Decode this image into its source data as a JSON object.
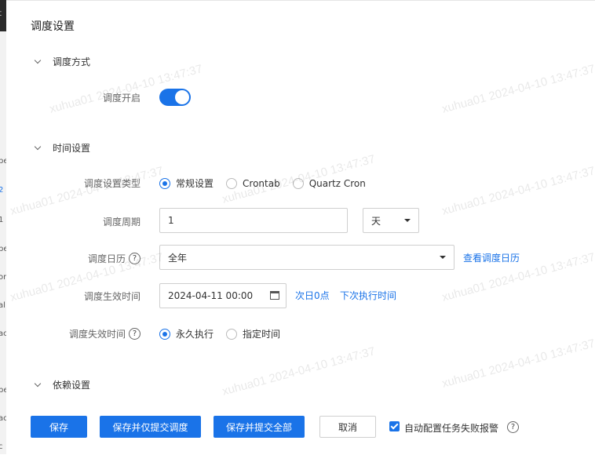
{
  "sidebar": {
    "fragments": [
      "t",
      "pe",
      "2",
      "1",
      "pe",
      "or",
      "al",
      "ac",
      "pe",
      "ac",
      "c"
    ]
  },
  "title": "调度设置",
  "sections": {
    "mode": "调度方式",
    "time": "时间设置",
    "deps": "依赖设置"
  },
  "schedule_enabled": {
    "label": "调度开启",
    "on": true
  },
  "type": {
    "label": "调度设置类型",
    "options": [
      "常规设置",
      "Crontab",
      "Quartz Cron"
    ],
    "selected": "常规设置"
  },
  "period": {
    "label": "调度周期",
    "value": "1",
    "unit": "天"
  },
  "calendar": {
    "label": "调度日历",
    "value": "全年",
    "link": "查看调度日历"
  },
  "effective": {
    "label": "调度生效时间",
    "value": "2024-04-11 00:00",
    "link1": "次日0点",
    "link2": "下次执行时间"
  },
  "expire": {
    "label": "调度失效时间",
    "options": [
      "永久执行",
      "指定时间"
    ],
    "selected": "永久执行"
  },
  "help_glyph": "?",
  "buttons": {
    "save": "保存",
    "save_submit_schedule": "保存并仅提交调度",
    "save_submit_all": "保存并提交全部",
    "cancel": "取消"
  },
  "auto_alarm": {
    "label": "自动配置任务失败报警",
    "checked": true
  },
  "watermark": "xuhua01 2024-04-10 13:47:37",
  "colors": {
    "accent": "#1a73e8"
  }
}
